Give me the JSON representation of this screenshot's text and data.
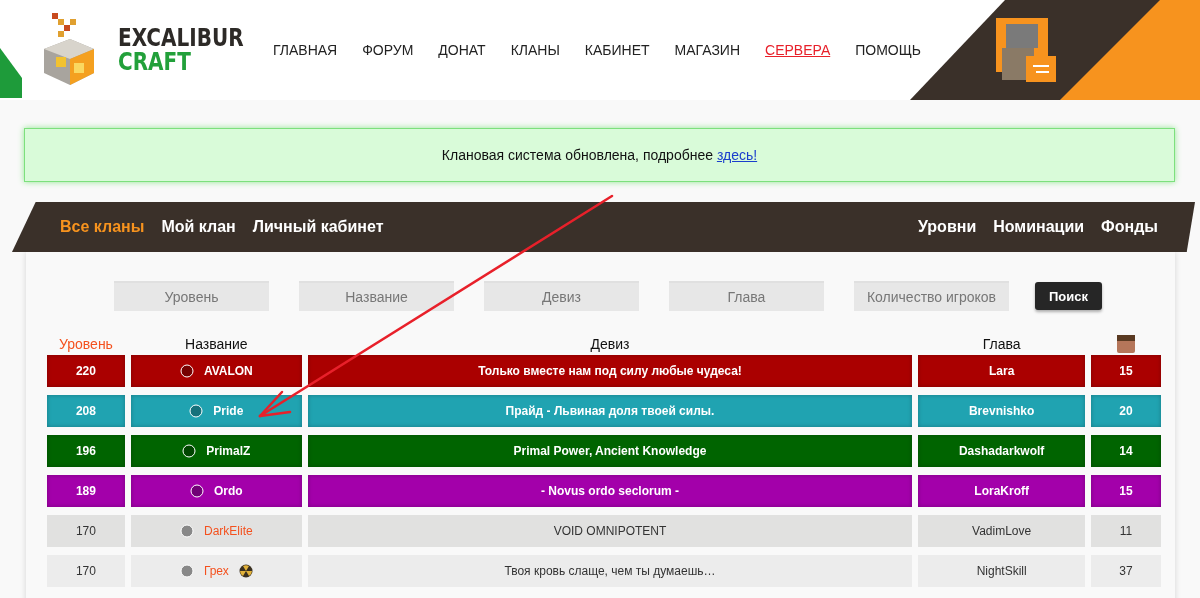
{
  "logo": {
    "line_1": "EXCALIBUR",
    "line_2": "CRAFT"
  },
  "nav": [
    {
      "label": "ГЛАВНАЯ",
      "selected": false
    },
    {
      "label": "ФОРУМ",
      "selected": false
    },
    {
      "label": "ДОНАТ",
      "selected": false
    },
    {
      "label": "КЛАНЫ",
      "selected": false
    },
    {
      "label": "КАБИНЕТ",
      "selected": false
    },
    {
      "label": "МАГАЗИН",
      "selected": false
    },
    {
      "label": "СЕРВЕРА",
      "selected": true
    },
    {
      "label": "ПОМОЩЬ",
      "selected": false
    }
  ],
  "notice": {
    "text": "Клановая система обновлена, подробнее",
    "link": "здесь!"
  },
  "tabs_left": [
    {
      "label": "Все кланы",
      "selected": true
    },
    {
      "label": "Мой клан",
      "selected": false
    },
    {
      "label": "Личный кабинет",
      "selected": false
    }
  ],
  "tabs_right": [
    {
      "label": "Уровни",
      "selected": false
    },
    {
      "label": "Номинации",
      "selected": false
    },
    {
      "label": "Фонды",
      "selected": false
    }
  ],
  "search": {
    "fields": [
      {
        "placeholder": "Уровень"
      },
      {
        "placeholder": "Название"
      },
      {
        "placeholder": "Девиз"
      },
      {
        "placeholder": "Глава"
      },
      {
        "placeholder": "Количество игроков"
      }
    ],
    "button": "Поиск"
  },
  "table": {
    "columns": [
      {
        "label": "Уровень",
        "selected": true
      },
      {
        "label": "Название",
        "selected": false
      },
      {
        "label": "Девиз",
        "selected": false
      },
      {
        "label": "Глава",
        "selected": false
      }
    ],
    "rows": [
      {
        "level": "220",
        "name": "AVALON",
        "motto": "Только вместе нам под силу любые чудеса!",
        "head": "Lara",
        "players": "15",
        "color": "#aa0000",
        "highlighted": true,
        "trailing_icon": false
      },
      {
        "level": "208",
        "name": "Pride",
        "motto": "Прайд - Львиная доля твоей силы.",
        "head": "Brevnishko",
        "players": "20",
        "color": "#20a3b1",
        "highlighted": true,
        "trailing_icon": false
      },
      {
        "level": "196",
        "name": "PrimalZ",
        "motto": "Primal Power, Ancient Knowledge",
        "head": "Dashadarkwolf",
        "players": "14",
        "color": "#006400",
        "highlighted": true,
        "trailing_icon": false
      },
      {
        "level": "189",
        "name": "Ordo",
        "motto": "- Novus ordo seclorum -",
        "head": "LoraKroff",
        "players": "15",
        "color": "#a300aa",
        "highlighted": true,
        "trailing_icon": false
      },
      {
        "level": "170",
        "name": "DarkElite",
        "motto": "VOID OMNIPOTENT",
        "head": "VadimLove",
        "players": "11",
        "color": "#e1e1e0",
        "highlighted": false,
        "trailing_icon": false
      },
      {
        "level": "170",
        "name": "Грех",
        "motto": "Твоя кровь слаще, чем ты думаешь…",
        "head": "NightSkill",
        "players": "37",
        "color": "#ececec",
        "highlighted": false,
        "trailing_icon": true
      }
    ]
  }
}
